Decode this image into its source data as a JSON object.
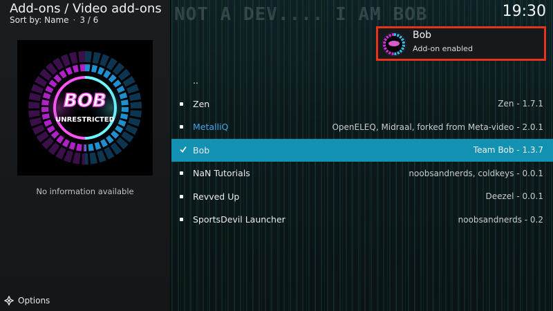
{
  "header": {
    "title": "Add-ons / Video add-ons",
    "sort_label": "Sort by: Name",
    "separator": "·",
    "position": "3 / 6"
  },
  "banner_text": "NOT A DEV.... I AM BOB",
  "clock": "19:30",
  "artwork": {
    "logo_text": "BOB",
    "caption": "UNRESTRICTED"
  },
  "info_text": "No information available",
  "options_label": "Options",
  "notification": {
    "title": "Bob",
    "message": "Add-on enabled"
  },
  "list": {
    "parent": "..",
    "items": [
      {
        "name": "Zen",
        "info": "Zen - 1.7.1"
      },
      {
        "name_prefix": "Metalli",
        "name_highlight": "Q",
        "info": "OpenELEQ, Midraal, forked from Meta-video - 2.0.1"
      },
      {
        "name": "Bob",
        "info": "Team Bob - 1.3.7",
        "selected": true
      },
      {
        "name": "NaN Tutorials",
        "info": "noobsandnerds, coldkeys - 0.0.1"
      },
      {
        "name": "Revved Up",
        "info": "Deezel - 0.0.1"
      },
      {
        "name": "SportsDevil Launcher",
        "info": "noobsandnerds - 0.2"
      }
    ]
  },
  "colors": {
    "selected_row": "#1291b3",
    "notification_border": "#e8331a",
    "highlight_text": "#3fa6e8"
  }
}
